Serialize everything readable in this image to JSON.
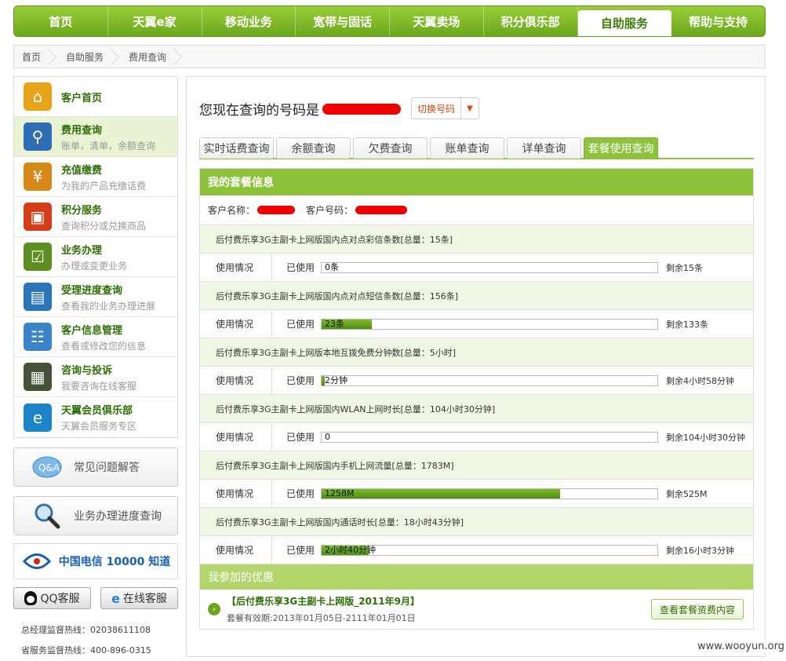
{
  "nav": [
    "首页",
    "天翼e家",
    "移动业务",
    "宽带与固话",
    "天翼卖场",
    "积分俱乐部",
    "自助服务",
    "帮助与支持"
  ],
  "nav_active": 6,
  "breadcrumb": [
    "首页",
    "自助服务",
    "费用查询"
  ],
  "sidebar": [
    {
      "title": "客户首页",
      "sub": "",
      "color": "#e8a31a",
      "icon": "home-icon",
      "glyph": "⌂"
    },
    {
      "title": "费用查询",
      "sub": "账单，清单，余额查询",
      "color": "#2f6db5",
      "icon": "magnifier-icon",
      "glyph": "⚲"
    },
    {
      "title": "充值缴费",
      "sub": "为我的产品充缴话费",
      "color": "#d8891a",
      "icon": "coin-icon",
      "glyph": "¥"
    },
    {
      "title": "积分服务",
      "sub": "查询积分或兑换商品",
      "color": "#d53c1a",
      "icon": "gift-icon",
      "glyph": "▣"
    },
    {
      "title": "业务办理",
      "sub": "办理或变更业务",
      "color": "#5c8f1f",
      "icon": "clipboard-icon",
      "glyph": "☑"
    },
    {
      "title": "受理进度查询",
      "sub": "查看我的业务办理进展",
      "color": "#2a74b8",
      "icon": "window-cursor-icon",
      "glyph": "▤"
    },
    {
      "title": "客户信息管理",
      "sub": "查看或修改您的信息",
      "color": "#3a84c9",
      "icon": "id-card-icon",
      "glyph": "☷"
    },
    {
      "title": "咨询与投诉",
      "sub": "我要咨询在线客服",
      "color": "#44523a",
      "icon": "calculator-warning-icon",
      "glyph": "▦"
    },
    {
      "title": "天翼会员俱乐部",
      "sub": "天翼会员服务专区",
      "color": "#1c84c8",
      "icon": "club-logo-icon",
      "glyph": "e"
    }
  ],
  "sidebar_active": 1,
  "faq_label": "常见问题解答",
  "progress_label": "业务办理进度查询",
  "brand_text": "中国电信 10000 知道",
  "qq_label": "QQ客服",
  "online_label": "在线客服",
  "hotlines": [
    "总经理监督热线：02038611108",
    "省服务监督热线：400-896-0315"
  ],
  "number_label": "您现在查询的号码是",
  "switch_label": "切换号码",
  "tabs": [
    "实时话费查询",
    "余额查询",
    "欠费查询",
    "账单查询",
    "详单查询",
    "套餐使用查询"
  ],
  "tabs_active": 5,
  "pkg_title": "我的套餐信息",
  "cust_name_label": "客户名称：",
  "cust_no_label": "客户号码：",
  "usage_label": "使用情况",
  "used_label": "已使用",
  "items": [
    {
      "title": "后付费乐享3G主副卡上网版国内点对点彩信条数[总量：15条]",
      "used": "0条",
      "pct": 0,
      "rest": "剩余15条"
    },
    {
      "title": "后付费乐享3G主副卡上网版国内点对点短信条数[总量：156条]",
      "used": "23条",
      "pct": 15,
      "rest": "剩余133条"
    },
    {
      "title": "后付费乐享3G主副卡上网版本地互拨免费分钟数[总量：5小时]",
      "used": "2分钟",
      "pct": 1,
      "rest": "剩余4小时58分钟"
    },
    {
      "title": "后付费乐享3G主副卡上网版国内WLAN上网时长[总量：104小时30分钟]",
      "used": "0",
      "pct": 0,
      "rest": "剩余104小时30分钟"
    },
    {
      "title": "后付费乐享3G主副卡上网版国内手机上网流量[总量：1783M]",
      "used": "1258M",
      "pct": 71,
      "rest": "剩余525M"
    },
    {
      "title": "后付费乐享3G主副卡上网版国内通话时长[总量：18小时43分钟]",
      "used": "2小时40分钟",
      "pct": 14,
      "rest": "剩余16小时3分钟"
    }
  ],
  "promo_head": "我参加的优惠",
  "promo": {
    "name": "【后付费乐享3G主副卡上网版_2011年9月】",
    "period": "套餐有效期:2013年01月05日-2111年01月01日",
    "button": "查看套餐资费内容"
  },
  "watermark": "www.wooyun.org"
}
